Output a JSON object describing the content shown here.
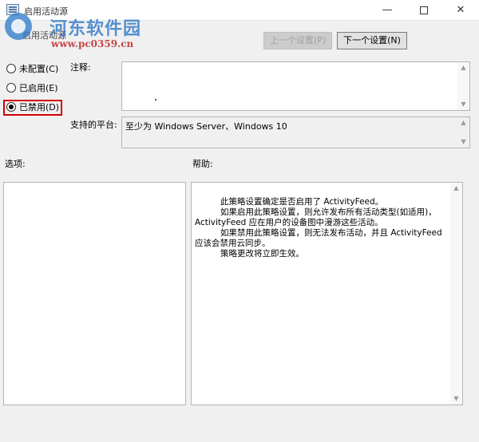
{
  "window": {
    "title": "启用活动源",
    "minimize_glyph": "—",
    "close_glyph": "✕"
  },
  "watermark": {
    "name": "河东软件园",
    "url": "www.pc0359.cn"
  },
  "header": {
    "policy_title": "启用活动源"
  },
  "nav": {
    "prev_label": "上一个设置(P)",
    "next_label": "下一个设置(N)"
  },
  "state_options": [
    {
      "label": "未配置(C)",
      "checked": false
    },
    {
      "label": "已启用(E)",
      "checked": false
    },
    {
      "label": "已禁用(D)",
      "checked": true
    }
  ],
  "labels": {
    "comment": "注释:",
    "platform": "支持的平台:",
    "options": "选项:",
    "help": "帮助:"
  },
  "platform_value": "至少为 Windows Server、Windows 10",
  "help_paragraphs": [
    "此策略设置确定是否启用了 ActivityFeed。",
    "如果启用此策略设置，则允许发布所有活动类型(如适用)，ActivityFeed 应在用户的设备图中漫游这些活动。",
    "如果禁用此策略设置，则无法发布活动，并且 ActivityFeed 应该会禁用云同步。",
    "策略更改将立即生效。"
  ],
  "colors": {
    "highlight_border": "#d40000",
    "window_bg": "#f0f0f0"
  },
  "icons": {
    "up": "▲",
    "down": "▼"
  }
}
